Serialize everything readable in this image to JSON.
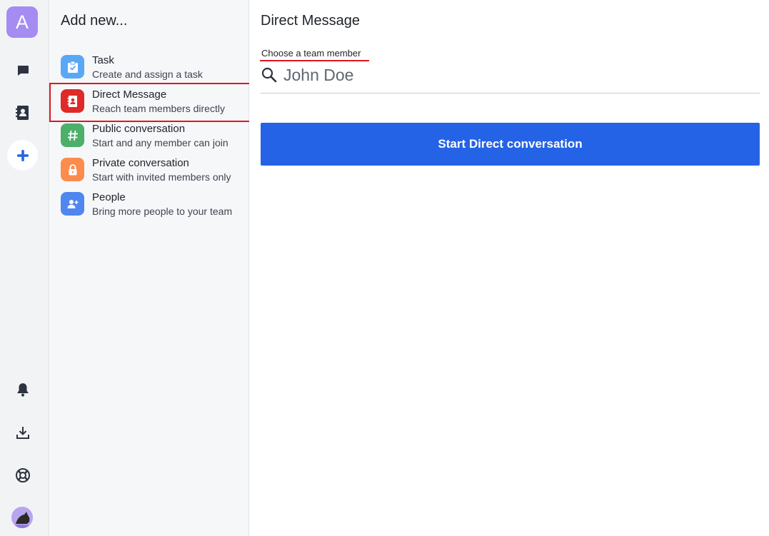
{
  "rail": {
    "workspace_initial": "A",
    "icons": [
      "chat-icon",
      "contacts-icon",
      "add-icon",
      "bell-icon",
      "download-icon",
      "help-icon",
      "user-avatar"
    ]
  },
  "panel": {
    "title": "Add new...",
    "items": [
      {
        "title": "Task",
        "subtitle": "Create and assign a task",
        "icon": "task-clipboard-icon",
        "color": "#5aa7f5"
      },
      {
        "title": "Direct Message",
        "subtitle": "Reach team members directly",
        "icon": "contact-card-icon",
        "color": "#e02929"
      },
      {
        "title": "Public conversation",
        "subtitle": "Start and any member can join",
        "icon": "hash-icon",
        "color": "#4caf6a"
      },
      {
        "title": "Private conversation",
        "subtitle": "Start with invited members only",
        "icon": "lock-icon",
        "color": "#fb8c4c"
      },
      {
        "title": "People",
        "subtitle": "Bring more people to your team",
        "icon": "add-person-icon",
        "color": "#4f86f0"
      }
    ]
  },
  "main": {
    "title": "Direct Message",
    "field_label": "Choose a team member",
    "search_placeholder": "John Doe",
    "start_button": "Start Direct conversation"
  },
  "colors": {
    "accent": "#2563e6",
    "highlight": "#e0161e",
    "workspace_avatar": "#a48cf2"
  }
}
